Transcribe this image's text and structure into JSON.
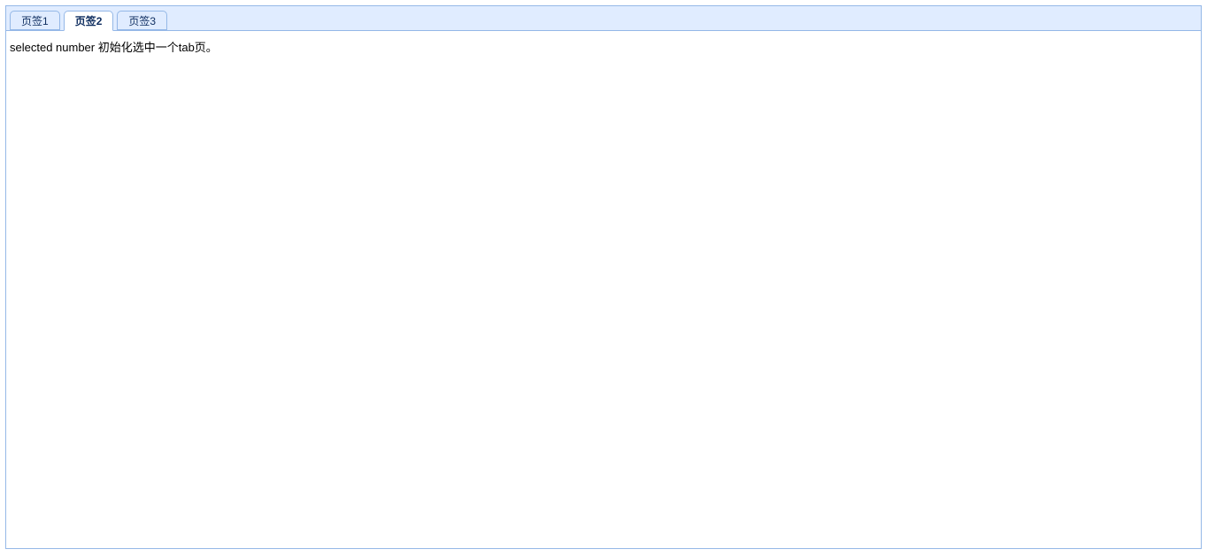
{
  "tabs": {
    "items": [
      {
        "label": "页签1",
        "selected": false
      },
      {
        "label": "页签2",
        "selected": true
      },
      {
        "label": "页签3",
        "selected": false
      }
    ]
  },
  "content": {
    "text": "selected number 初始化选中一个tab页。"
  }
}
